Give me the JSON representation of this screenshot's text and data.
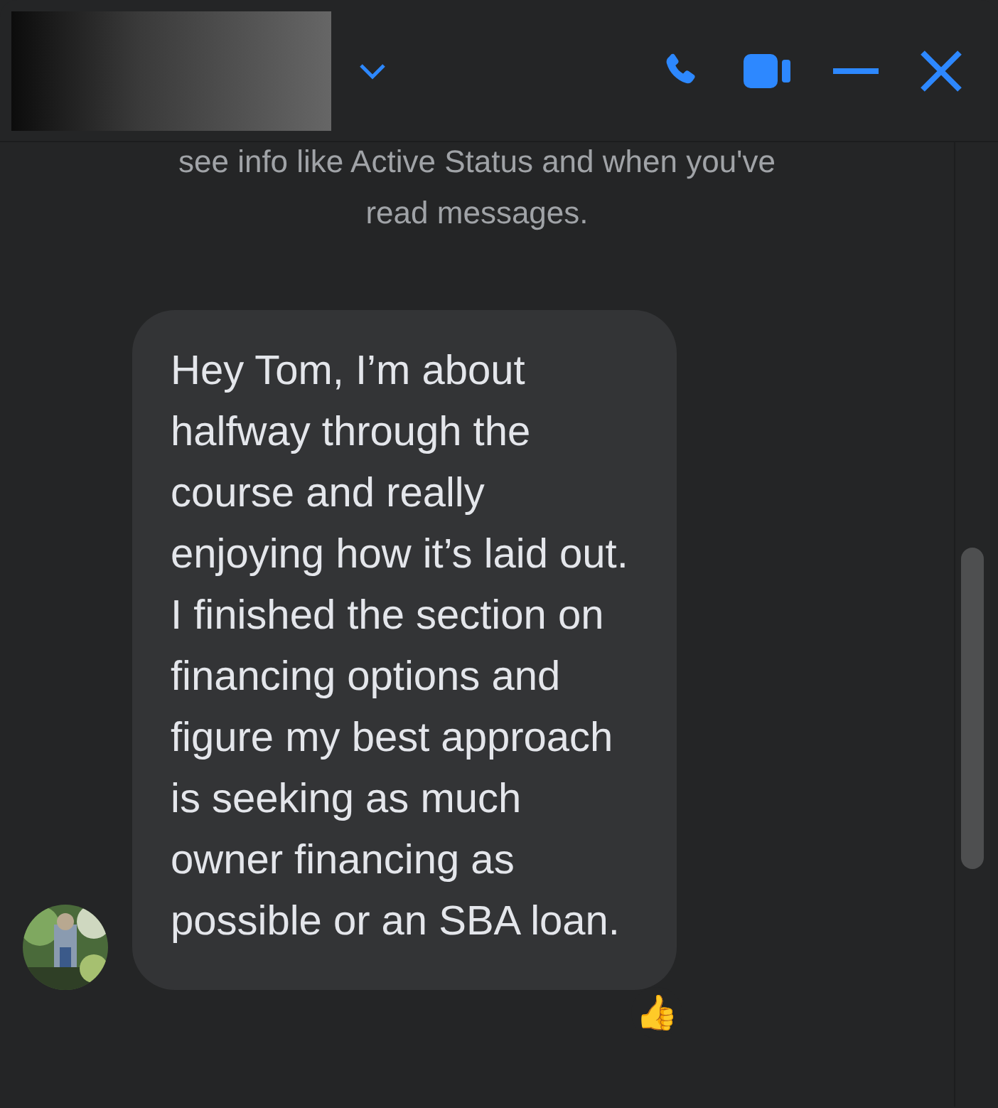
{
  "notice": {
    "lines": [
      "see info like Active Status and when you've",
      "read messages."
    ]
  },
  "message": {
    "text": "Hey Tom, I’m about halfway through the course and really enjoying how it’s laid out. I finished the section on financing options and figure my best approach is seeking as much owner financing as possible or an SBA loan.",
    "reaction": "👍"
  }
}
